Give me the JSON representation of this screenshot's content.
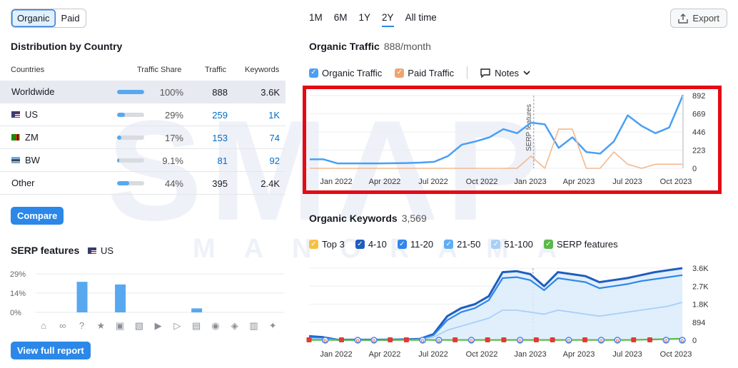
{
  "tabs": [
    {
      "label": "Organic",
      "active": true
    },
    {
      "label": "Paid",
      "active": false
    }
  ],
  "distribution": {
    "title": "Distribution by Country",
    "columns": {
      "country": "Countries",
      "share": "Traffic Share",
      "traffic": "Traffic",
      "keywords": "Keywords"
    },
    "rows": [
      {
        "name": "Worldwide",
        "flag": "",
        "share_pct": 100,
        "share": "100%",
        "traffic": "888",
        "keywords": "3.6K",
        "selected": true,
        "link": false
      },
      {
        "name": "US",
        "flag": "us",
        "share_pct": 29,
        "share": "29%",
        "traffic": "259",
        "keywords": "1K",
        "selected": false,
        "link": true
      },
      {
        "name": "ZM",
        "flag": "zm",
        "share_pct": 17,
        "share": "17%",
        "traffic": "153",
        "keywords": "74",
        "selected": false,
        "link": true
      },
      {
        "name": "BW",
        "flag": "bw",
        "share_pct": 9.1,
        "share": "9.1%",
        "traffic": "81",
        "keywords": "92",
        "selected": false,
        "link": true
      },
      {
        "name": "Other",
        "flag": "",
        "share_pct": 44,
        "share": "44%",
        "traffic": "395",
        "keywords": "2.4K",
        "selected": false,
        "link": false
      }
    ],
    "compare_label": "Compare"
  },
  "serp": {
    "title": "SERP features",
    "country": "US",
    "view_report_label": "View full report",
    "chart_data": {
      "type": "bar",
      "y_ticks": [
        "29%",
        "14%",
        "0%"
      ],
      "ylim": [
        0,
        29
      ],
      "categories": [
        "featured-snippet",
        "sitelinks",
        "people-also-ask",
        "reviews",
        "image",
        "image-pack",
        "video",
        "featured-video",
        "knowledge-panel",
        "local-pack",
        "academic",
        "news",
        "twitter"
      ],
      "values": [
        0,
        0,
        0,
        0,
        0,
        0,
        0,
        0,
        0,
        0,
        0,
        0,
        0
      ],
      "bars": [
        {
          "category": "people-also-ask",
          "value": 23
        },
        {
          "category": "image",
          "value": 21
        },
        {
          "category": "knowledge-panel",
          "value": 3
        }
      ]
    }
  },
  "periods": [
    {
      "label": "1M",
      "active": false
    },
    {
      "label": "6M",
      "active": false
    },
    {
      "label": "1Y",
      "active": false
    },
    {
      "label": "2Y",
      "active": true
    },
    {
      "label": "All time",
      "active": false
    }
  ],
  "export_label": "Export",
  "organic_traffic": {
    "title": "Organic Traffic",
    "value": "888/month",
    "legend": [
      {
        "label": "Organic Traffic",
        "color": "#4a9ff5"
      },
      {
        "label": "Paid Traffic",
        "color": "#f0a46c"
      }
    ],
    "notes_label": "Notes",
    "annotation": "SERP features",
    "colors": {
      "organic": "#4a9ff5",
      "paid": "#f3b88f",
      "frame": "#e50914"
    },
    "chart_data": {
      "type": "line",
      "x_labels": [
        "Jan 2022",
        "Apr 2022",
        "Jul 2022",
        "Oct 2022",
        "Jan 2023",
        "Apr 2023",
        "Jul 2023",
        "Oct 2023"
      ],
      "y_ticks": [
        "892",
        "669",
        "446",
        "223",
        "0"
      ],
      "ylim": [
        0,
        892
      ],
      "series": [
        {
          "name": "Organic Traffic",
          "values": [
            110,
            110,
            60,
            60,
            60,
            60,
            62,
            65,
            70,
            80,
            150,
            290,
            330,
            380,
            480,
            430,
            560,
            540,
            250,
            380,
            200,
            180,
            330,
            650,
            520,
            430,
            500,
            900
          ]
        },
        {
          "name": "Paid Traffic",
          "values": [
            0,
            0,
            0,
            0,
            0,
            0,
            0,
            0,
            0,
            0,
            0,
            0,
            0,
            0,
            0,
            0,
            150,
            0,
            480,
            480,
            0,
            0,
            200,
            50,
            0,
            50,
            50,
            50
          ]
        }
      ]
    }
  },
  "organic_keywords": {
    "title": "Organic Keywords",
    "value": "3,569",
    "legend": [
      {
        "label": "Top 3",
        "color": "#f6c142"
      },
      {
        "label": "4-10",
        "color": "#1f5dbf"
      },
      {
        "label": "11-20",
        "color": "#2f86eb"
      },
      {
        "label": "21-50",
        "color": "#5eaef5"
      },
      {
        "label": "51-100",
        "color": "#a7d0f8"
      },
      {
        "label": "SERP features",
        "color": "#5bb84a"
      }
    ],
    "chart_data": {
      "type": "area",
      "x_labels": [
        "Jan 2022",
        "Apr 2022",
        "Jul 2022",
        "Oct 2022",
        "Jan 2023",
        "Apr 2023",
        "Jul 2023",
        "Oct 2023"
      ],
      "y_ticks": [
        "3.6K",
        "2.7K",
        "1.8K",
        "894",
        "0"
      ],
      "ylim": [
        0,
        3600
      ],
      "series": [
        {
          "name": "4-10",
          "values": [
            200,
            150,
            30,
            20,
            20,
            20,
            30,
            40,
            60,
            300,
            1200,
            1600,
            1800,
            2200,
            3400,
            3450,
            3300,
            2700,
            3400,
            3300,
            3200,
            2900,
            3000,
            3100,
            3250,
            3400,
            3500,
            3600
          ]
        },
        {
          "name": "11-20",
          "values": [
            150,
            100,
            20,
            15,
            15,
            15,
            20,
            30,
            50,
            250,
            1000,
            1400,
            1600,
            2000,
            3100,
            3150,
            3000,
            2500,
            3100,
            3000,
            2900,
            2600,
            2700,
            2800,
            2950,
            3050,
            3150,
            3250
          ]
        },
        {
          "name": "51-100",
          "values": [
            80,
            60,
            10,
            10,
            10,
            10,
            10,
            15,
            30,
            150,
            500,
            700,
            900,
            1100,
            1500,
            1500,
            1400,
            1300,
            1500,
            1400,
            1300,
            1200,
            1300,
            1400,
            1500,
            1600,
            1700,
            1900
          ]
        },
        {
          "name": "SERP features",
          "values": [
            10,
            10,
            10,
            10,
            10,
            10,
            10,
            10,
            10,
            10,
            10,
            10,
            10,
            10,
            10,
            10,
            10,
            10,
            10,
            10,
            10,
            10,
            10,
            10,
            20,
            40,
            60,
            80
          ]
        }
      ]
    }
  },
  "watermark": {
    "main": "SMAP",
    "sub": "MANORAMA"
  }
}
